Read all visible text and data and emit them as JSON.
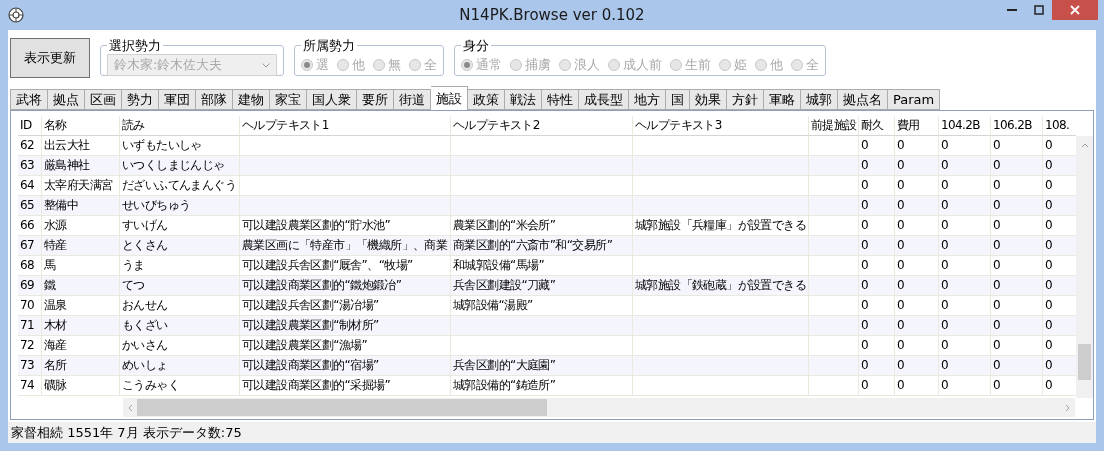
{
  "window": {
    "title": "N14PK.Browse ver 0.102"
  },
  "refresh_button": {
    "label": "表示更新"
  },
  "faction_select": {
    "label": "選択勢力",
    "value": "鈴木家:鈴木佐大夫",
    "disabled": true
  },
  "affiliation": {
    "label": "所属勢力",
    "disabled": true,
    "options": [
      {
        "label": "選",
        "selected": true
      },
      {
        "label": "他",
        "selected": false
      },
      {
        "label": "無",
        "selected": false
      },
      {
        "label": "全",
        "selected": false
      }
    ]
  },
  "status": {
    "label": "身分",
    "disabled": true,
    "options": [
      {
        "label": "通常",
        "selected": true
      },
      {
        "label": "捕虜",
        "selected": false
      },
      {
        "label": "浪人",
        "selected": false
      },
      {
        "label": "成人前",
        "selected": false
      },
      {
        "label": "生前",
        "selected": false
      },
      {
        "label": "姫",
        "selected": false
      },
      {
        "label": "他",
        "selected": false
      },
      {
        "label": "全",
        "selected": false
      }
    ]
  },
  "tabs": [
    {
      "label": "武将",
      "selected": false
    },
    {
      "label": "拠点",
      "selected": false
    },
    {
      "label": "区画",
      "selected": false
    },
    {
      "label": "勢力",
      "selected": false
    },
    {
      "label": "軍団",
      "selected": false
    },
    {
      "label": "部隊",
      "selected": false
    },
    {
      "label": "建物",
      "selected": false
    },
    {
      "label": "家宝",
      "selected": false
    },
    {
      "label": "国人衆",
      "selected": false
    },
    {
      "label": "要所",
      "selected": false
    },
    {
      "label": "街道",
      "selected": false
    },
    {
      "label": "施設",
      "selected": true
    },
    {
      "label": "政策",
      "selected": false
    },
    {
      "label": "戦法",
      "selected": false
    },
    {
      "label": "特性",
      "selected": false
    },
    {
      "label": "成長型",
      "selected": false
    },
    {
      "label": "地方",
      "selected": false
    },
    {
      "label": "国",
      "selected": false
    },
    {
      "label": "効果",
      "selected": false
    },
    {
      "label": "方針",
      "selected": false
    },
    {
      "label": "軍略",
      "selected": false
    },
    {
      "label": "城郭",
      "selected": false
    },
    {
      "label": "拠点名",
      "selected": false
    },
    {
      "label": "Param",
      "selected": false
    }
  ],
  "table": {
    "columns": [
      "ID",
      "名称",
      "読み",
      "ヘルプテキスト1",
      "ヘルプテキスト2",
      "ヘルプテキスト3",
      "前提施設",
      "耐久",
      "費用",
      "104.2B",
      "106.2B",
      "108."
    ],
    "rows": [
      [
        "62",
        "出云大社",
        "いずもたいしゃ",
        null,
        null,
        null,
        null,
        "0",
        "0",
        "0",
        "0",
        "0"
      ],
      [
        "63",
        "厳島神社",
        "いつくしまじんじゃ",
        null,
        null,
        null,
        null,
        "0",
        "0",
        "0",
        "0",
        "0"
      ],
      [
        "64",
        "太宰府天满宮",
        "だざいふてんまんぐう",
        null,
        null,
        null,
        null,
        "0",
        "0",
        "0",
        "0",
        "0"
      ],
      [
        "65",
        "整備中",
        "せいびちゅう",
        null,
        null,
        null,
        null,
        "0",
        "0",
        "0",
        "0",
        "0"
      ],
      [
        "66",
        "水源",
        "すいげん",
        "可以建設農業区劃的“貯水池”",
        "農業区劃的“米会所”",
        "城郭施設「兵糧庫」が設置できる",
        null,
        "0",
        "0",
        "0",
        "0",
        "0"
      ],
      [
        "67",
        "特産",
        "とくさん",
        "農業区画に「特産市」「機織所」、商業",
        "商業区劃的“六斎市”和“交易所”",
        null,
        null,
        "0",
        "0",
        "0",
        "0",
        "0"
      ],
      [
        "68",
        "馬",
        "うま",
        "可以建設兵舎区劃“厩舎”、“牧場”",
        "和城郭設備“馬場”",
        null,
        null,
        "0",
        "0",
        "0",
        "0",
        "0"
      ],
      [
        "69",
        "鐵",
        "てつ",
        "可以建設商業区劃的“鐵炮鍛冶”",
        "兵舎区劃建設“刀藏”",
        "城郭施設「鉄砲蔵」が設置できる",
        null,
        "0",
        "0",
        "0",
        "0",
        "0"
      ],
      [
        "70",
        "温泉",
        "おんせん",
        "可以建設兵舎区劃“湯冶場”",
        "城郭設備“湯殿”",
        null,
        null,
        "0",
        "0",
        "0",
        "0",
        "0"
      ],
      [
        "71",
        "木材",
        "もくざい",
        "可以建設農業区劃“制材所”",
        null,
        null,
        null,
        "0",
        "0",
        "0",
        "0",
        "0"
      ],
      [
        "72",
        "海産",
        "かいさん",
        "可以建設農業区劃“漁場”",
        null,
        null,
        null,
        "0",
        "0",
        "0",
        "0",
        "0"
      ],
      [
        "73",
        "名所",
        "めいしょ",
        "可以建設商業区劃的“宿場”",
        "兵舎区劃的“大庭園”",
        null,
        null,
        "0",
        "0",
        "0",
        "0",
        "0"
      ],
      [
        "74",
        "礦脉",
        "こうみゃく",
        "可以建設商業区劃的“采掘場”",
        "城郭設備的“鋳造所”",
        null,
        null,
        "0",
        "0",
        "0",
        "0",
        "0"
      ]
    ]
  },
  "status_bar": {
    "text": "家督相続 1551年 7月 表示データ数:75"
  }
}
